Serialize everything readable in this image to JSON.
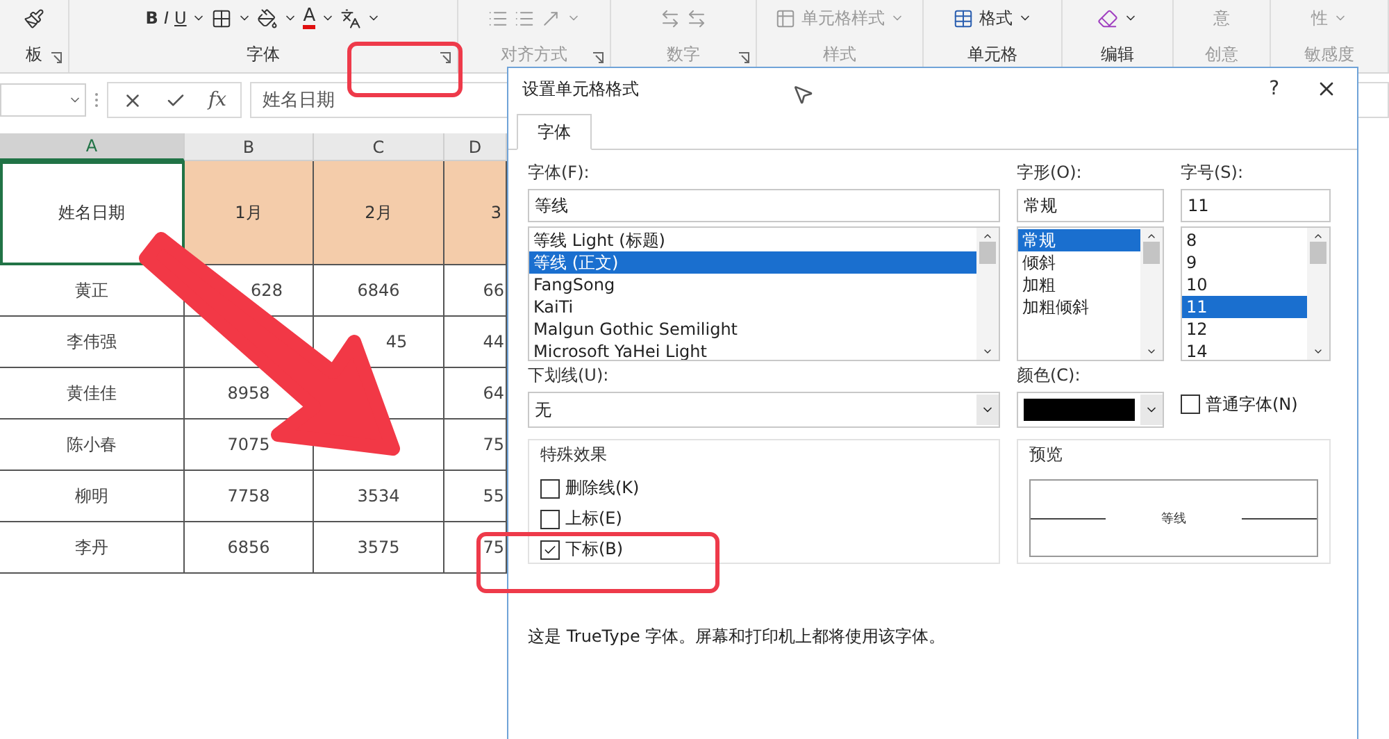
{
  "ribbon": {
    "groups": [
      {
        "label": "板",
        "disabled": false,
        "launcher": true,
        "tools": [
          {
            "kind": "brush"
          }
        ]
      },
      {
        "label": "字体",
        "disabled": false,
        "launcher": true,
        "tools": [
          {
            "kind": "text",
            "text": "B"
          },
          {
            "kind": "text",
            "text": "I"
          },
          {
            "kind": "text",
            "text": "U"
          },
          {
            "kind": "caret"
          },
          {
            "kind": "borders"
          },
          {
            "kind": "caret"
          },
          {
            "kind": "fill"
          },
          {
            "kind": "caret"
          },
          {
            "kind": "font-color",
            "text": "A"
          },
          {
            "kind": "caret"
          },
          {
            "kind": "phonetic"
          },
          {
            "kind": "caret"
          }
        ]
      },
      {
        "label": "对齐方式",
        "disabled": true,
        "launcher": true,
        "tools": [
          {
            "kind": "indent"
          },
          {
            "kind": "indent"
          },
          {
            "kind": "orientation"
          },
          {
            "kind": "caret"
          }
        ]
      },
      {
        "label": "数字",
        "disabled": true,
        "launcher": true,
        "tools": [
          {
            "kind": "decimal"
          },
          {
            "kind": "decimal"
          }
        ]
      },
      {
        "label": "样式",
        "disabled": true,
        "launcher": false,
        "tools": [
          {
            "kind": "cell-styles"
          },
          {
            "kind": "text",
            "text": "单元格样式"
          },
          {
            "kind": "caret"
          }
        ]
      },
      {
        "label": "单元格",
        "disabled": false,
        "launcher": false,
        "tools": [
          {
            "kind": "format"
          },
          {
            "kind": "text",
            "text": "格式"
          },
          {
            "kind": "caret"
          }
        ]
      },
      {
        "label": "编辑",
        "disabled": false,
        "launcher": false,
        "tools": [
          {
            "kind": "eraser"
          },
          {
            "kind": "caret"
          }
        ]
      },
      {
        "label": "创意",
        "disabled": true,
        "launcher": false,
        "tools": [
          {
            "kind": "text",
            "text": "意"
          }
        ]
      },
      {
        "label": "敏感度",
        "disabled": true,
        "launcher": false,
        "tools": [
          {
            "kind": "text",
            "text": "性"
          },
          {
            "kind": "caret"
          }
        ]
      }
    ]
  },
  "formula_bar": {
    "fx": "fx",
    "value": "姓名日期"
  },
  "sheet": {
    "columns": [
      {
        "label": "A",
        "selected": true
      },
      {
        "label": "B",
        "selected": false
      },
      {
        "label": "C",
        "selected": false
      },
      {
        "label": "D",
        "selected": false
      }
    ],
    "header_row": [
      {
        "text": "姓名日期",
        "selected": true
      },
      {
        "text": "1月",
        "selected": false
      },
      {
        "text": "2月",
        "selected": false
      },
      {
        "text": "3",
        "selected": false
      }
    ],
    "rows": [
      {
        "A": "黄正",
        "B": "628",
        "C": "6846",
        "D": "66"
      },
      {
        "A": "李伟强",
        "C": "45",
        "D": "44"
      },
      {
        "A": "黄佳佳",
        "B": "8958",
        "D": "64"
      },
      {
        "A": "陈小春",
        "B": "7075",
        "D": "75"
      },
      {
        "A": "柳明",
        "B": "7758",
        "C": "3534",
        "D": "55"
      },
      {
        "A": "李丹",
        "B": "6856",
        "C": "3575",
        "D": "75"
      }
    ]
  },
  "dialog": {
    "title": "设置单元格格式",
    "help": "?",
    "tabs": [
      {
        "label": "字体",
        "selected": true
      }
    ],
    "font": {
      "label": "字体(F):",
      "value": "等线",
      "options": [
        {
          "text": "等线 Light (标题)",
          "selected": false
        },
        {
          "text": "等线 (正文)",
          "selected": true
        },
        {
          "text": "FangSong",
          "selected": false
        },
        {
          "text": "KaiTi",
          "selected": false
        },
        {
          "text": "Malgun Gothic Semilight",
          "selected": false
        },
        {
          "text": "Microsoft YaHei Light",
          "selected": false
        }
      ]
    },
    "style": {
      "label": "字形(O):",
      "value": "常规",
      "options": [
        {
          "text": "常规",
          "selected": true
        },
        {
          "text": "倾斜",
          "selected": false
        },
        {
          "text": "加粗",
          "selected": false
        },
        {
          "text": "加粗倾斜",
          "selected": false
        }
      ]
    },
    "size": {
      "label": "字号(S):",
      "value": "11",
      "options": [
        {
          "text": "8",
          "selected": false
        },
        {
          "text": "9",
          "selected": false
        },
        {
          "text": "10",
          "selected": false
        },
        {
          "text": "11",
          "selected": true
        },
        {
          "text": "12",
          "selected": false
        },
        {
          "text": "14",
          "selected": false
        }
      ]
    },
    "underline": {
      "label": "下划线(U):",
      "value": "无"
    },
    "color": {
      "label": "颜色(C):",
      "color": "#000000"
    },
    "normal_font": {
      "label": "普通字体(N)",
      "checked": false
    },
    "effects": {
      "title": "特殊效果",
      "options": [
        {
          "label": "删除线(K)",
          "checked": false
        },
        {
          "label": "上标(E)",
          "checked": false
        },
        {
          "label": "下标(B)",
          "checked": true
        }
      ]
    },
    "preview": {
      "title": "预览",
      "sample": "等线"
    },
    "note": "这是 TrueType 字体。屏幕和打印机上都将使用该字体。"
  },
  "annotations": [
    {
      "kind": "arrow"
    },
    {
      "kind": "frame"
    },
    {
      "kind": "frame"
    }
  ]
}
